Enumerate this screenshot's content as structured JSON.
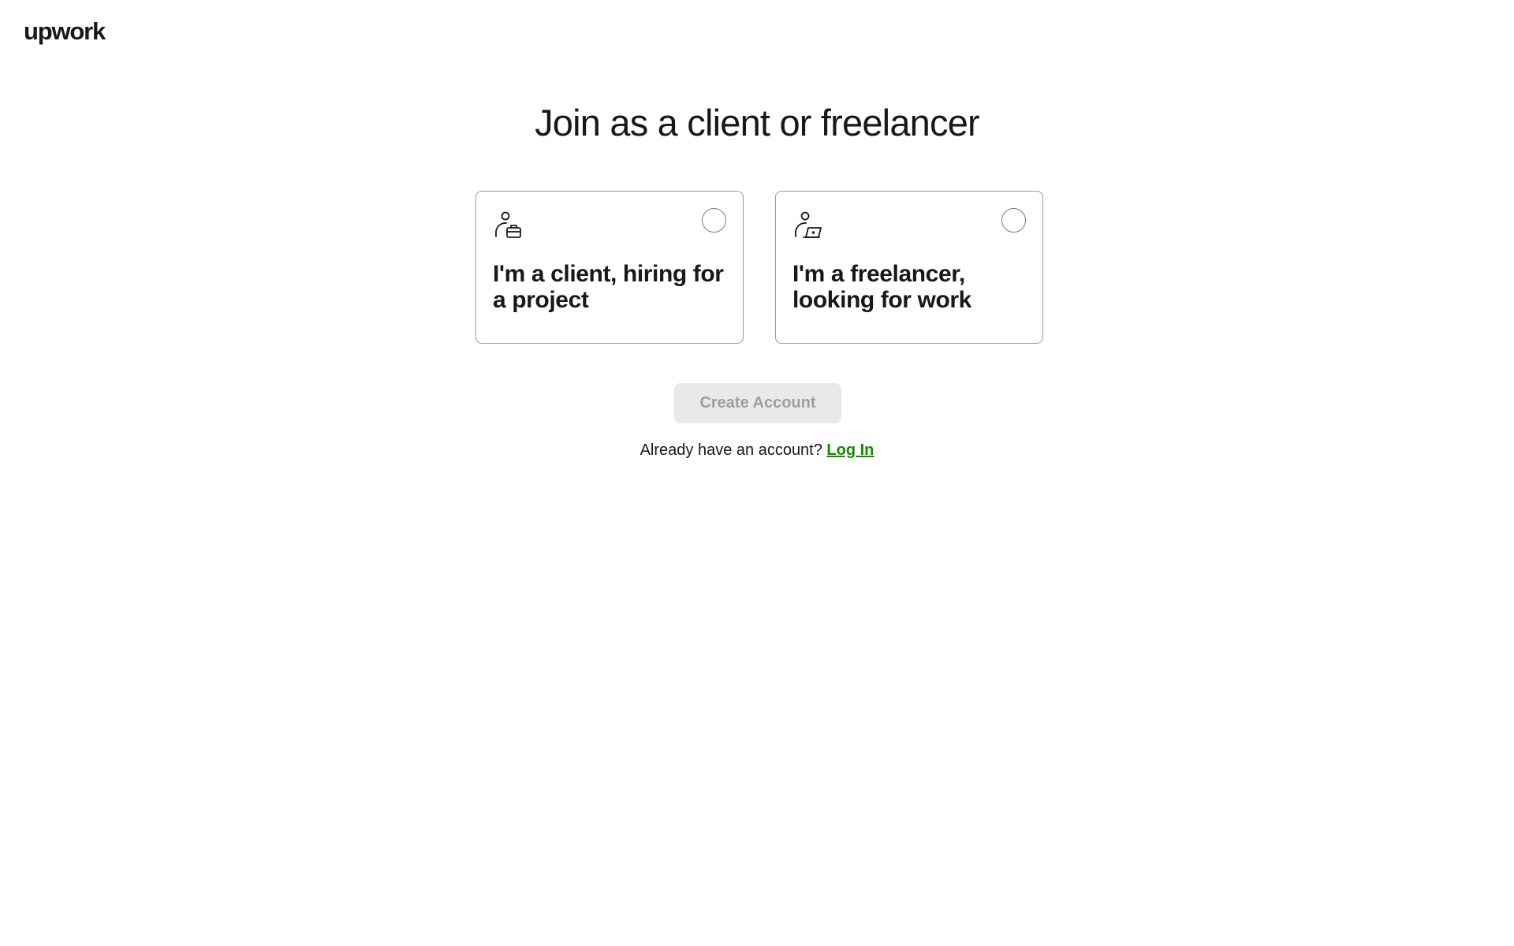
{
  "header": {
    "logo_text": "upwork"
  },
  "main": {
    "title": "Join as a client or freelancer",
    "cards": [
      {
        "label": "I'm a client, hiring for a project",
        "icon": "client-briefcase-icon",
        "selected": false
      },
      {
        "label": "I'm a freelancer, looking for work",
        "icon": "freelancer-laptop-icon",
        "selected": false
      }
    ],
    "create_account_label": "Create Account",
    "login_prompt": "Already have an account?",
    "login_link": "Log In"
  },
  "colors": {
    "text": "#181818",
    "link": "#108a00",
    "disabled_button_bg": "#e9e9e9",
    "disabled_button_text": "#9e9e9e",
    "card_border": "#9a9a9a"
  }
}
